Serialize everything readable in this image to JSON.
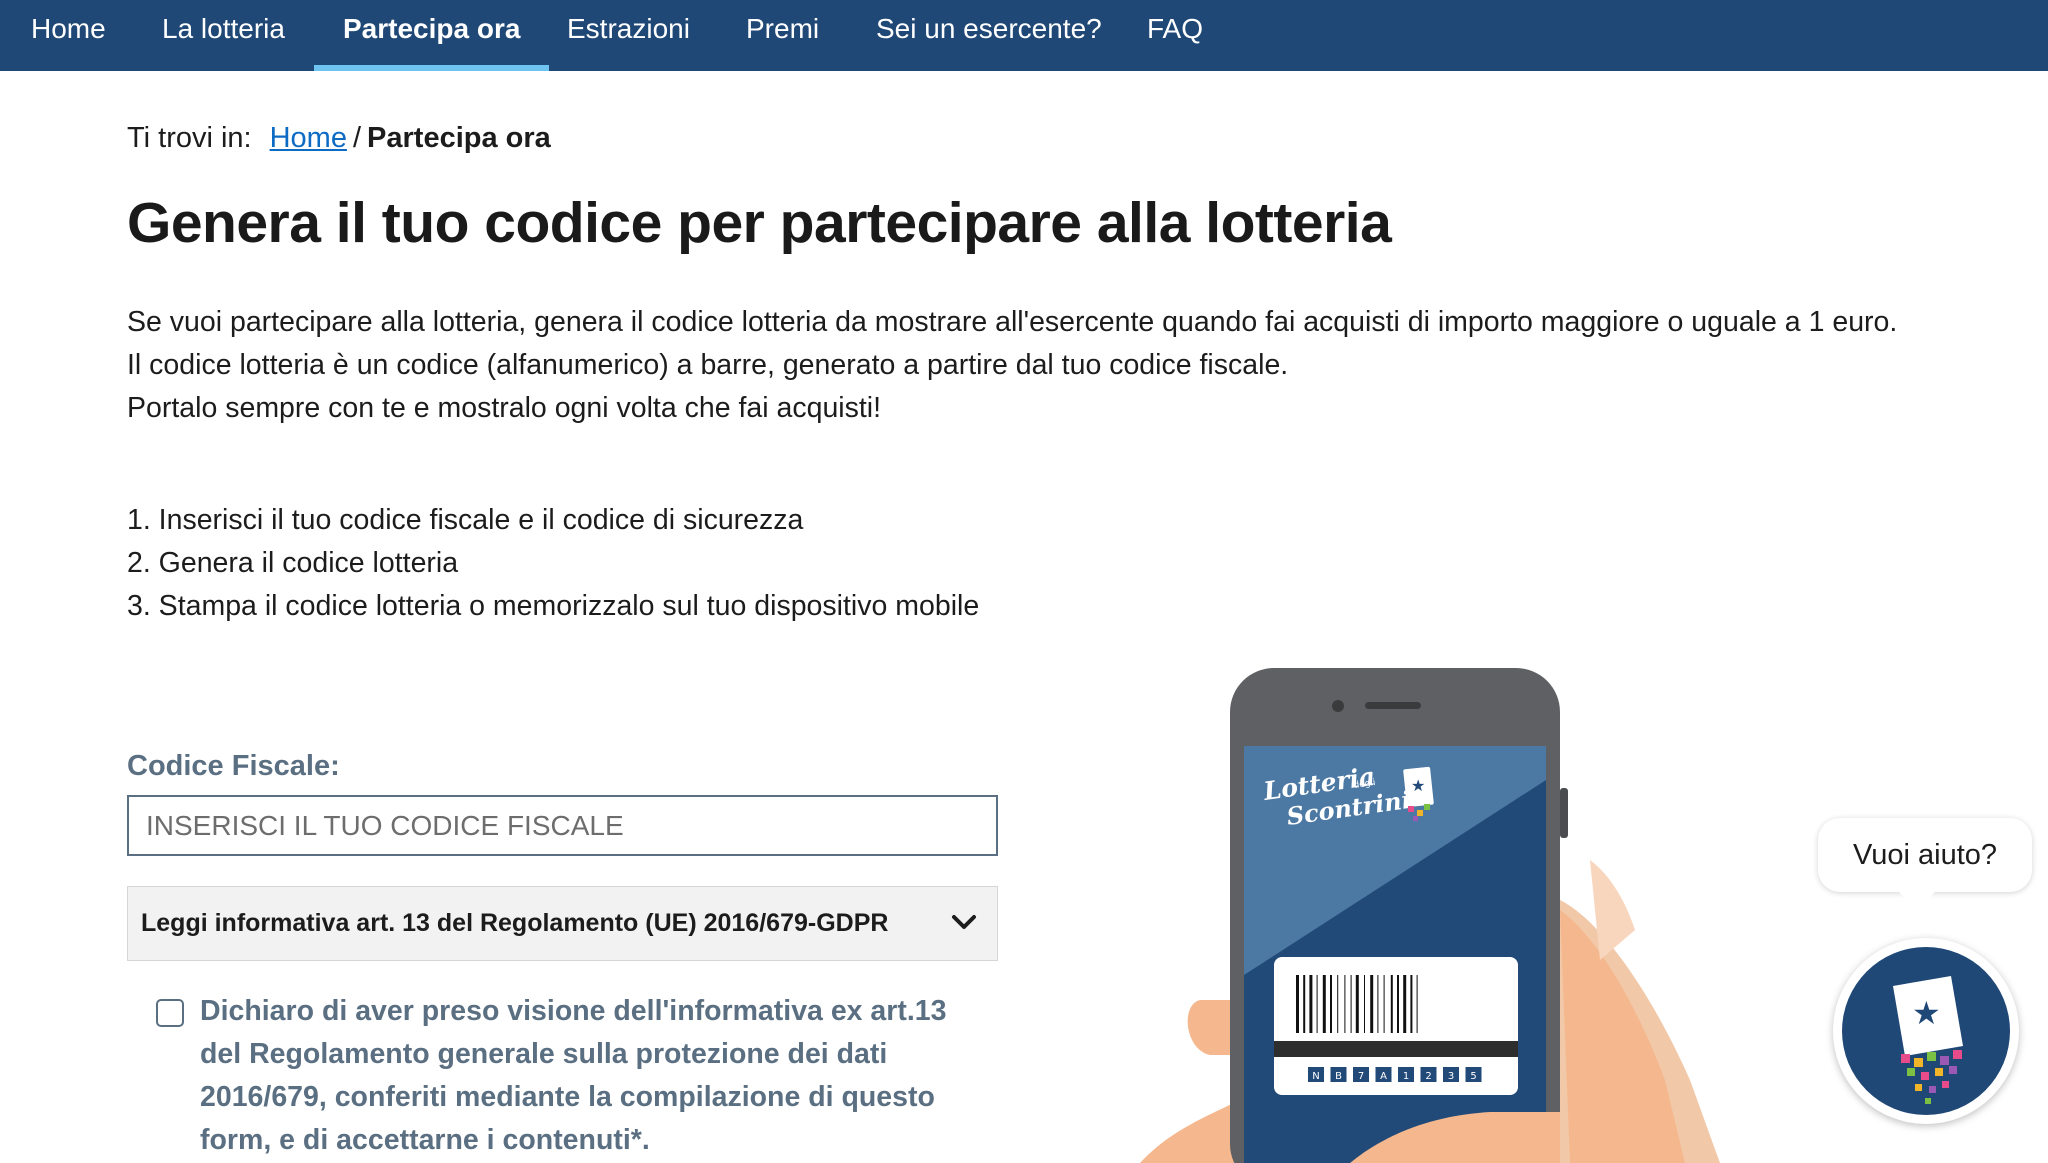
{
  "nav": {
    "items": [
      {
        "label": "Home"
      },
      {
        "label": "La lotteria"
      },
      {
        "label": "Partecipa ora",
        "active": true
      },
      {
        "label": "Estrazioni"
      },
      {
        "label": "Premi"
      },
      {
        "label": "Sei un esercente?"
      },
      {
        "label": "FAQ"
      }
    ]
  },
  "breadcrumb": {
    "prefix": "Ti trovi in:",
    "home": "Home",
    "separator": "/",
    "current": "Partecipa ora"
  },
  "page": {
    "title": "Genera il tuo codice per partecipare alla lotteria",
    "intro": [
      "Se vuoi partecipare alla lotteria, genera il codice lotteria da mostrare all'esercente quando fai acquisti di importo maggiore o uguale a 1 euro.",
      "Il codice lotteria è un codice (alfanumerico) a barre, generato a partire dal tuo codice fiscale.",
      "Portalo sempre con te e mostralo ogni volta che fai acquisti!"
    ],
    "steps": [
      "1. Inserisci il tuo codice fiscale e il codice di sicurezza",
      "2. Genera il codice lotteria",
      "3. Stampa il codice lotteria o memorizzalo sul tuo dispositivo mobile"
    ]
  },
  "form": {
    "cf_label": "Codice Fiscale:",
    "cf_placeholder": "INSERISCI IL TUO CODICE FISCALE",
    "cf_value": "",
    "privacy_accordion": "Leggi informativa art. 13 del Regolamento (UE) 2016/679-GDPR",
    "consent_text": "Dichiaro di aver preso visione dell'informativa ex art.13 del Regolamento generale sulla protezione dei dati 2016/679, conferiti mediante la compilazione di questo form, e di accettarne i contenuti*.",
    "consent_checked": false
  },
  "illustration": {
    "logo_line1": "Lotteria",
    "logo_small": "degli",
    "logo_line2": "Scontrini",
    "code_chars": [
      "N",
      "B",
      "7",
      "A",
      "1",
      "2",
      "3",
      "5"
    ]
  },
  "help": {
    "bubble": "Vuoi aiuto?"
  },
  "colors": {
    "nav_bg": "#1f4876",
    "nav_active_underline": "#6ec3f1",
    "link": "#0d6bc4",
    "form_label": "#5b6f82"
  },
  "icons": {
    "accordion": "chevron-down-icon",
    "help": "lottery-ticket-icon"
  }
}
